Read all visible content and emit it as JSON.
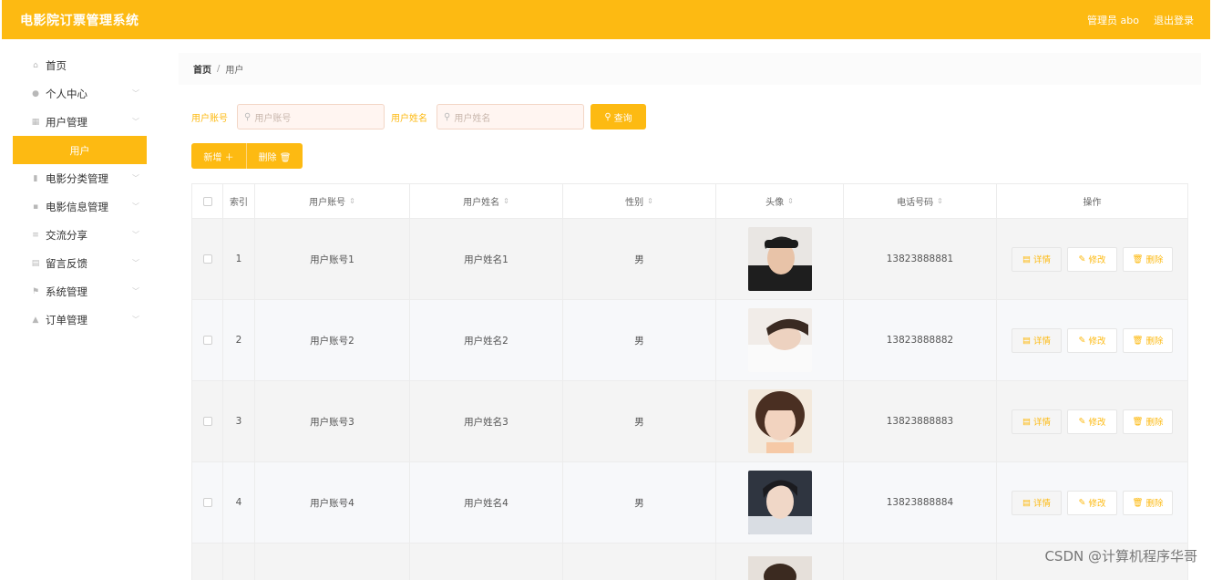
{
  "header": {
    "title": "电影院订票管理系统",
    "admin": "管理员 abo",
    "logout": "退出登录"
  },
  "sidebar": {
    "items": [
      {
        "label": "首页",
        "icon": "home-icon",
        "glyph": "⌂",
        "expandable": false
      },
      {
        "label": "个人中心",
        "icon": "user-icon",
        "glyph": "●",
        "expandable": true
      },
      {
        "label": "用户管理",
        "icon": "grid-icon",
        "glyph": "▦",
        "expandable": true
      },
      {
        "label": "电影分类管理",
        "icon": "bar-chart-icon",
        "glyph": "▮",
        "expandable": true
      },
      {
        "label": "电影信息管理",
        "icon": "apps-icon",
        "glyph": "▪",
        "expandable": true
      },
      {
        "label": "交流分享",
        "icon": "share-icon",
        "glyph": "≡",
        "expandable": true
      },
      {
        "label": "留言反馈",
        "icon": "message-icon",
        "glyph": "▤",
        "expandable": true
      },
      {
        "label": "系统管理",
        "icon": "flag-icon",
        "glyph": "⚑",
        "expandable": true
      },
      {
        "label": "订单管理",
        "icon": "order-icon",
        "glyph": "▲",
        "expandable": true
      }
    ],
    "active_sub": "用户"
  },
  "breadcrumb": {
    "home": "首页",
    "separator": "/",
    "current": "用户"
  },
  "search": {
    "account_label": "用户账号",
    "account_placeholder": "用户账号",
    "name_label": "用户姓名",
    "name_placeholder": "用户姓名",
    "button": "查询"
  },
  "actions": {
    "add": "新增 ＋",
    "delete": "删除 🗑"
  },
  "table": {
    "headers": {
      "index": "索引",
      "account": "用户账号",
      "name": "用户姓名",
      "sex": "性别",
      "avatar": "头像",
      "phone": "电话号码",
      "ops": "操作"
    },
    "rows": [
      {
        "index": "1",
        "account": "用户账号1",
        "name": "用户姓名1",
        "sex": "男",
        "phone": "13823888881"
      },
      {
        "index": "2",
        "account": "用户账号2",
        "name": "用户姓名2",
        "sex": "男",
        "phone": "13823888882"
      },
      {
        "index": "3",
        "account": "用户账号3",
        "name": "用户姓名3",
        "sex": "男",
        "phone": "13823888883"
      },
      {
        "index": "4",
        "account": "用户账号4",
        "name": "用户姓名4",
        "sex": "男",
        "phone": "13823888884"
      }
    ],
    "row_actions": {
      "detail": "详情",
      "edit": "修改",
      "delete": "删除"
    }
  },
  "watermark": "CSDN @计算机程序华哥",
  "colors": {
    "accent": "#fdba12"
  }
}
